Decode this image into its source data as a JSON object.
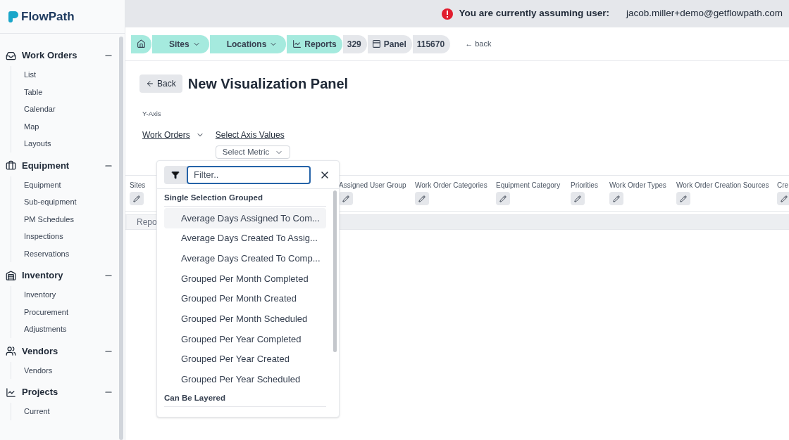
{
  "brand": {
    "name": "FlowPath"
  },
  "sidebar": {
    "sections": [
      {
        "kind": "inbox",
        "title": "Work Orders",
        "expanded": true,
        "items": [
          "List",
          "Table",
          "Calendar",
          "Map",
          "Layouts"
        ]
      },
      {
        "kind": "toolbox",
        "title": "Equipment",
        "expanded": true,
        "items": [
          "Equipment",
          "Sub-equipment",
          "PM Schedules",
          "Inspections",
          "Reservations"
        ]
      },
      {
        "kind": "shelves",
        "title": "Inventory",
        "expanded": true,
        "items": [
          "Inventory",
          "Procurement",
          "Adjustments"
        ]
      },
      {
        "kind": "people",
        "title": "Vendors",
        "expanded": true,
        "items": [
          "Vendors"
        ]
      },
      {
        "kind": "chart",
        "title": "Projects",
        "expanded": true,
        "items": [
          "Current"
        ]
      }
    ]
  },
  "banner": {
    "label": "You are currently assuming user:",
    "user": "jacob.miller+demo@getflowpath.com"
  },
  "breadcrumb": [
    {
      "kind": "home",
      "active": true
    },
    {
      "kind": "menu",
      "label": "Sites",
      "active": true
    },
    {
      "kind": "menu",
      "label": "Locations",
      "active": true
    },
    {
      "kind": "chart",
      "label": "Reports",
      "active": true
    },
    {
      "kind": "text",
      "label": "329",
      "active": false
    },
    {
      "kind": "panel",
      "label": "Panel",
      "active": false
    },
    {
      "kind": "text",
      "label": "115670",
      "active": false
    }
  ],
  "back_link": "← back",
  "page": {
    "back_button": "Back",
    "title": "New Visualization Panel"
  },
  "y_axis": {
    "label": "Y-Axis",
    "entity": "Work Orders",
    "axis_values_link": "Select Axis Values",
    "metric_select": "Select Metric"
  },
  "filter_columns": [
    "Sites",
    "Assigned User Group",
    "Work Order Categories",
    "Equipment Category",
    "Priorities",
    "Work Order Types",
    "Work Order Creation Sources",
    "Cre"
  ],
  "report_tab": "Repo",
  "dropdown": {
    "filter_placeholder": "Filter..",
    "groups": [
      {
        "title": "Single Selection Grouped",
        "options": [
          {
            "label": "Average Days Assigned To Com...",
            "selected": true
          },
          {
            "label": "Average Days Created To Assig...",
            "selected": false
          },
          {
            "label": "Average Days Created To Comp...",
            "selected": false
          },
          {
            "label": "Grouped Per Month Completed",
            "selected": false
          },
          {
            "label": "Grouped Per Month Created",
            "selected": false
          },
          {
            "label": "Grouped Per Month Scheduled",
            "selected": false
          },
          {
            "label": "Grouped Per Year Completed",
            "selected": false
          },
          {
            "label": "Grouped Per Year Created",
            "selected": false
          },
          {
            "label": "Grouped Per Year Scheduled",
            "selected": false
          }
        ]
      },
      {
        "title": "Can Be Layered"
      }
    ]
  }
}
